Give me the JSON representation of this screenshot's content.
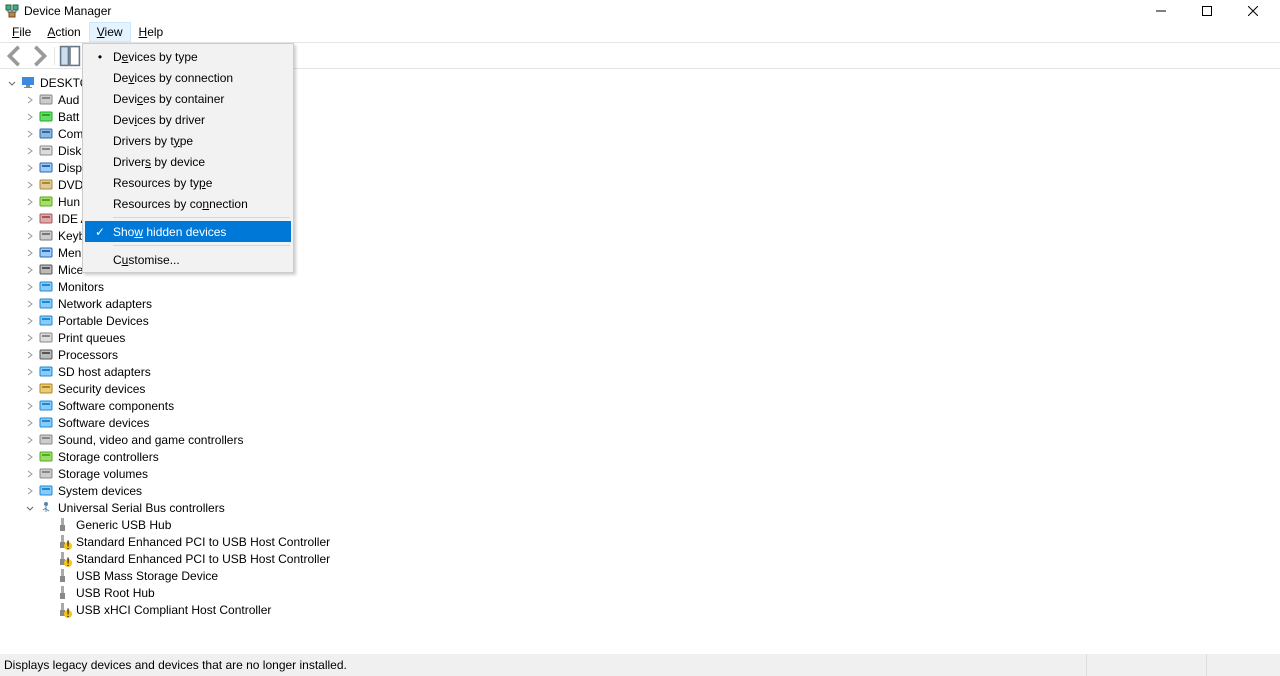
{
  "window": {
    "title": "Device Manager",
    "minimize_tip": "Minimize",
    "maximize_tip": "Maximize",
    "close_tip": "Close"
  },
  "menubar": {
    "file": "File",
    "action": "Action",
    "view": "View",
    "help": "Help"
  },
  "view_menu": {
    "devices_by_type": "Devices by type",
    "devices_by_connection": "Devices by connection",
    "devices_by_container": "Devices by container",
    "devices_by_driver": "Devices by driver",
    "drivers_by_type": "Drivers by type",
    "drivers_by_device": "Drivers by device",
    "resources_by_type": "Resources by type",
    "resources_by_connection": "Resources by connection",
    "show_hidden": "Show hidden devices",
    "customise": "Customise...",
    "current_view": "devices_by_type",
    "show_hidden_checked": true
  },
  "tree": {
    "root": "DESKTO",
    "categories": [
      "Aud",
      "Batt",
      "Com",
      "Disk",
      "Disp",
      "DVD",
      "Hun",
      "IDE A",
      "Keyb",
      "Men",
      "Mice",
      "Monitors",
      "Network adapters",
      "Portable Devices",
      "Print queues",
      "Processors",
      "SD host adapters",
      "Security devices",
      "Software components",
      "Software devices",
      "Sound, video and game controllers",
      "Storage controllers",
      "Storage volumes",
      "System devices"
    ],
    "usb": {
      "label": "Universal Serial Bus controllers",
      "children": [
        "Generic USB Hub",
        "Standard Enhanced PCI to USB Host Controller",
        "Standard Enhanced PCI to USB Host Controller",
        "USB Mass Storage Device",
        "USB Root Hub",
        "USB xHCI Compliant Host Controller"
      ]
    }
  },
  "statusbar": {
    "text": "Displays legacy devices and devices that are no longer installed."
  }
}
